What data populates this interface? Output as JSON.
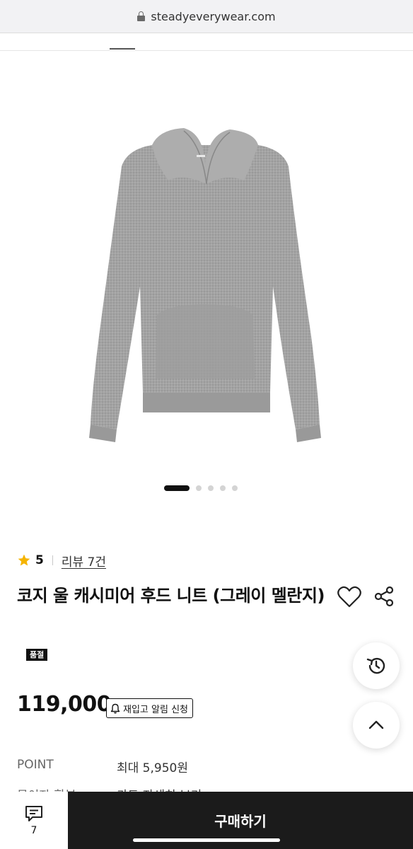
{
  "browser": {
    "url": "steadyeverywear.com"
  },
  "carousel": {
    "total": 5,
    "active_index": 0
  },
  "rating": {
    "value": "5",
    "review_link": "리뷰 7건"
  },
  "product": {
    "title": "코지 울 캐시미어 후드 니트 (그레이 멜란지)",
    "sold_out_badge": "품절",
    "price": "119,000",
    "restock_button": "재입고 알림 신청"
  },
  "info": {
    "point_label": "POINT",
    "point_value": "최대 5,950원",
    "partial_label": "무이자 할부",
    "partial_value": "카드 자세히 보기"
  },
  "bottom_bar": {
    "chat_count": "7",
    "buy_label": "구매하기"
  },
  "colors": {
    "accent": "#111111",
    "star": "#f5b400",
    "buy_bg": "#1b1b1b"
  }
}
